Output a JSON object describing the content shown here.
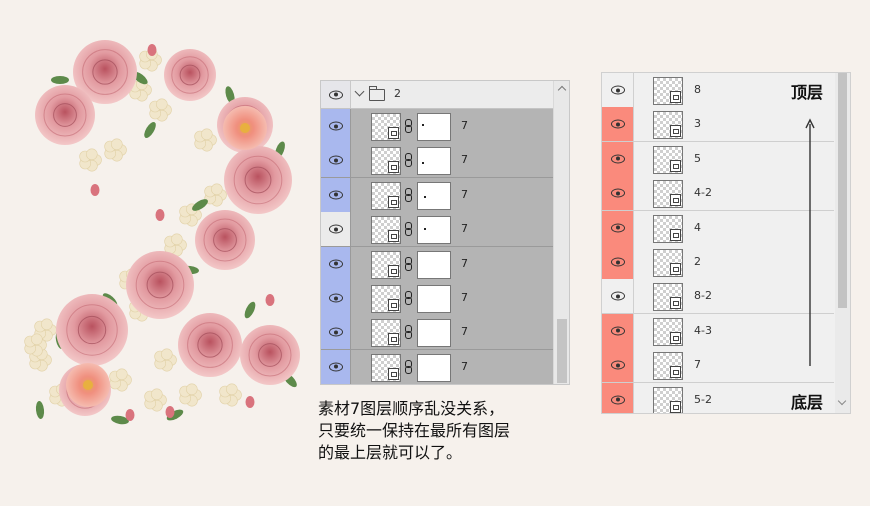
{
  "left_panel": {
    "group": {
      "name": "2",
      "expanded": true
    },
    "layers": [
      {
        "name": "7",
        "visible_highlight": true
      },
      {
        "name": "7",
        "visible_highlight": true
      },
      {
        "name": "7",
        "visible_highlight": true
      },
      {
        "name": "7",
        "visible_highlight": false
      },
      {
        "name": "7",
        "visible_highlight": true
      },
      {
        "name": "7",
        "visible_highlight": true
      },
      {
        "name": "7",
        "visible_highlight": true
      },
      {
        "name": "7",
        "visible_highlight": true
      }
    ]
  },
  "note": {
    "line1": "素材7图层顺序乱没关系，",
    "line2": "只要统一保持在最所有图层",
    "line3": "的最上层就可以了。"
  },
  "right_panel": {
    "layers": [
      {
        "name": "8",
        "color": "none"
      },
      {
        "name": "3",
        "color": "red"
      },
      {
        "name": "5",
        "color": "red"
      },
      {
        "name": "4-2",
        "color": "red"
      },
      {
        "name": "4",
        "color": "red"
      },
      {
        "name": "2",
        "color": "red"
      },
      {
        "name": "8-2",
        "color": "none"
      },
      {
        "name": "4-3",
        "color": "red"
      },
      {
        "name": "7",
        "color": "red"
      },
      {
        "name": "5-2",
        "color": "red"
      }
    ],
    "top_label": "顶层",
    "bottom_label": "底层"
  },
  "colors": {
    "background": "#f6f1ec",
    "highlight_blue": "#a9b8ee",
    "highlight_red": "#fa8a7c",
    "rose_pink": "#e4959a",
    "rose_dark": "#c96c76",
    "cream_flower": "#f1e6cb",
    "leaf_green": "#5d8a4a"
  },
  "icons": {
    "visibility": "eye-icon",
    "group": "folder-icon",
    "expand": "chevron-down-icon",
    "link": "chain-link-icon",
    "smart_object": "smart-object-badge-icon"
  }
}
